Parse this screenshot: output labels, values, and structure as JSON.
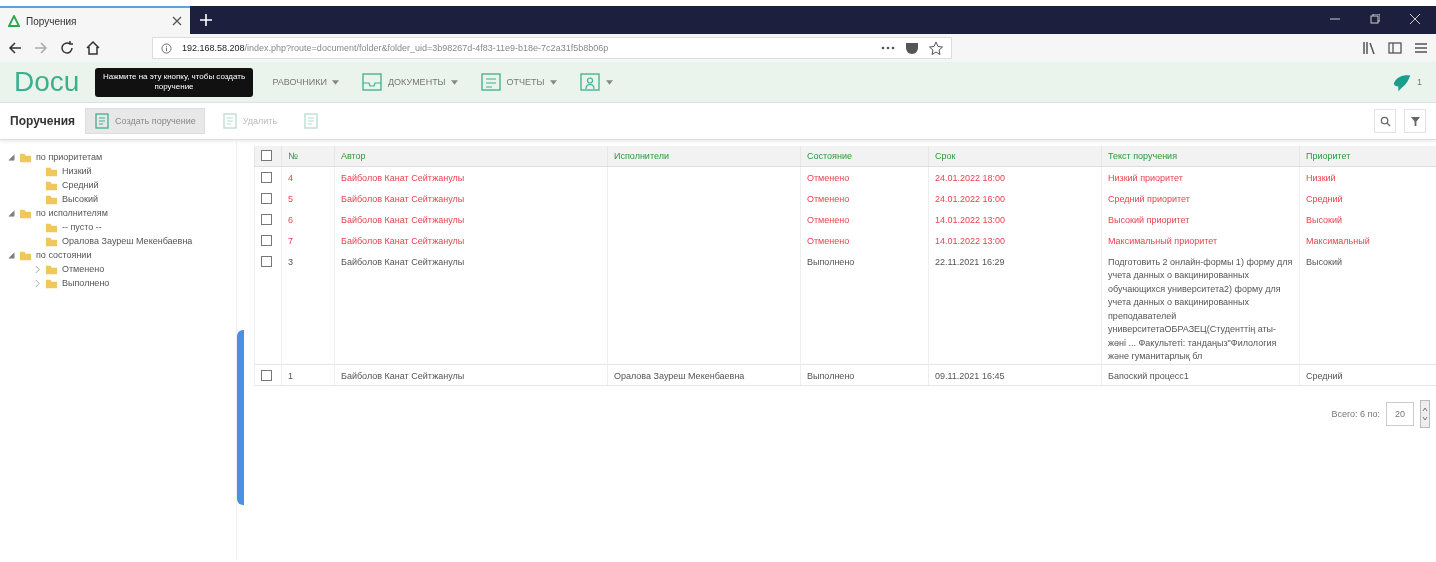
{
  "browser": {
    "tab_title": "Поручения",
    "url_host": "192.168.58.208",
    "url_path": "/index.php?route=document/folder&folder_uid=3b98267d-4f83-11e9-b18e-7c2a31f5b8b06p"
  },
  "app": {
    "logo": "Docu",
    "menu": [
      {
        "label": "РАВОЧНИКИ",
        "icon": false
      },
      {
        "label": "ДОКУМЕНТЫ",
        "icon": true
      },
      {
        "label": "ОТЧЕТЫ",
        "icon": true
      },
      {
        "icon": true
      }
    ],
    "notification_count": "1"
  },
  "tooltip": "Нажмите на эту кнопку, чтобы создать поручение",
  "toolbar": {
    "title": "Поручения",
    "buttons": [
      {
        "label": "Создать поручение",
        "disabled": false
      },
      {
        "label": "Удалить",
        "disabled": true
      },
      {
        "disabled": true
      }
    ]
  },
  "sidebar": {
    "tree": [
      {
        "label": "по приоритетам",
        "expanded": true,
        "children": [
          {
            "label": "Низкий"
          },
          {
            "label": "Средний"
          },
          {
            "label": "Высокий"
          }
        ]
      },
      {
        "label": "по исполнителям",
        "expanded": true,
        "children": [
          {
            "label": "-- пусто --"
          },
          {
            "label": "Оралова Зауреш Мекенбаевна"
          }
        ]
      },
      {
        "label": "по состоянии",
        "expanded": true,
        "children": [
          {
            "label": "Отменено",
            "expanded": false
          },
          {
            "label": "Выполнено",
            "expanded": false
          }
        ]
      }
    ]
  },
  "table": {
    "all_checked": false,
    "columns": [
      "№",
      "Автор",
      "Исполнители",
      "Состояние",
      "Срок",
      "Текст поручения",
      "Приоритет"
    ],
    "rows": [
      {
        "checked": false,
        "cancelled": true,
        "cells": [
          "4",
          "Байболов Канат Сейтжанулы",
          "",
          "Отменено",
          "24.01.2022 18:00",
          "Низкий приоритет",
          "Низкий"
        ]
      },
      {
        "checked": false,
        "cancelled": true,
        "cells": [
          "5",
          "Байболов Канат Сейтжанулы",
          "",
          "Отменено",
          "24.01.2022 16:00",
          "Средний приоритет",
          "Средний"
        ]
      },
      {
        "checked": false,
        "cancelled": true,
        "cells": [
          "6",
          "Байболов Канат Сейтжанулы",
          "",
          "Отменено",
          "14.01.2022 13:00",
          "Высокий приоритет",
          "Высокий"
        ]
      },
      {
        "checked": false,
        "cancelled": true,
        "cells": [
          "7",
          "Байболов Канат Сейтжанулы",
          "",
          "Отменено",
          "14.01.2022 13:00",
          "Максимальный приоритет",
          "Максимальный"
        ]
      },
      {
        "checked": false,
        "cancelled": false,
        "cells": [
          "3",
          "Байболов Канат Сейтжанулы",
          "",
          "Выполнено",
          "22.11.2021 16:29",
          "Подготовить 2 онлайн-формы 1) форму для учета данных о вакцинированных обучающихся университета2) форму для учета данных о вакцинированных преподавателей университетаОБРАЗЕЦ(Студенттің аты-жөні ... Факультеті: тандаңыз\"Филология және гуманитарлық бл",
          "Высокий"
        ]
      },
      {
        "checked": false,
        "cancelled": false,
        "cells": [
          "1",
          "Байболов Канат Сейтжанулы",
          "Оралова Зауреш Мекенбаевна",
          "Выполнено",
          "09.11.2021 16:45",
          "Бапоский процесс1",
          "Средний"
        ]
      }
    ]
  },
  "pager": {
    "label": "Всего: 6 по:",
    "page_size": "20"
  }
}
